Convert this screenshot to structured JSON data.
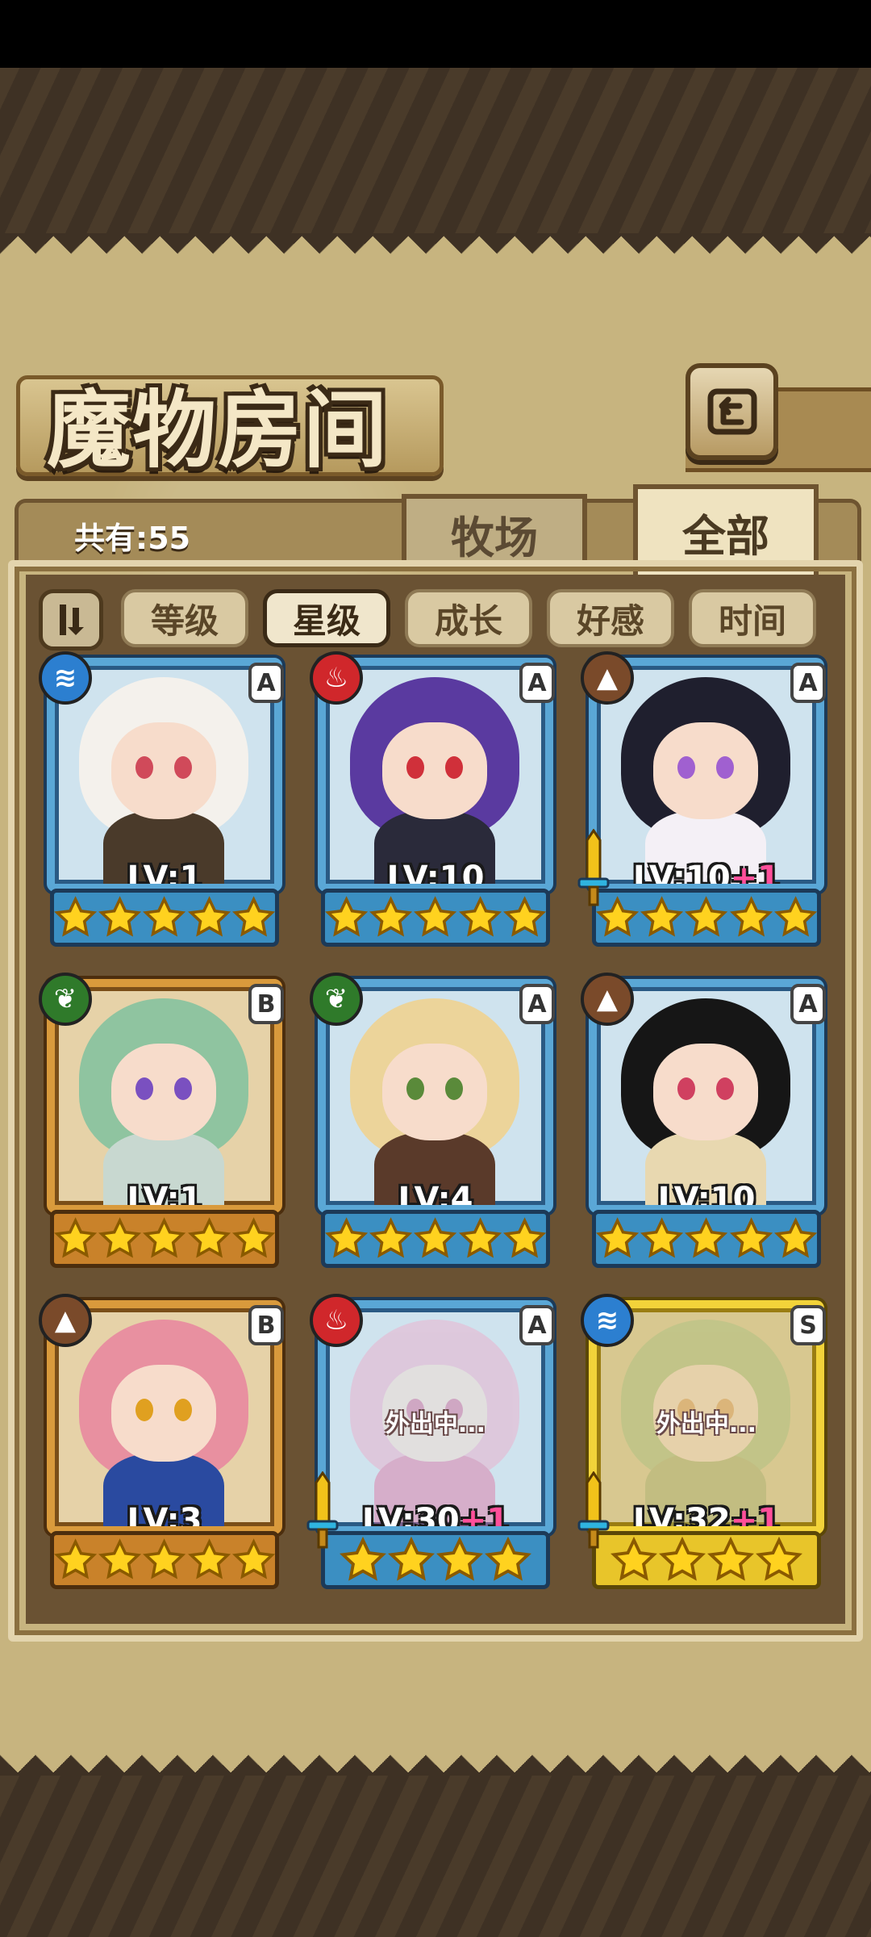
{
  "header": {
    "title": "魔物房间",
    "count": "共有:55"
  },
  "tabs": [
    {
      "label": "牧场"
    },
    {
      "label": "全部",
      "selected": true
    }
  ],
  "filters": {
    "sort_icon": "sort-toggle-icon",
    "options": [
      {
        "label": "等级",
        "active": false
      },
      {
        "label": "星级",
        "active": true
      },
      {
        "label": "成长",
        "active": false
      },
      {
        "label": "好感",
        "active": false
      },
      {
        "label": "时间",
        "active": false
      }
    ]
  },
  "monsters": [
    {
      "element": "water",
      "rank": "A",
      "level": "LV:1",
      "bonus": "",
      "stars": 5,
      "frame": "blue",
      "status": "",
      "hair": "#f4f1ec",
      "eye": "#d04a5a",
      "outfit": "#4a3a2a"
    },
    {
      "element": "fire",
      "rank": "A",
      "level": "LV:10",
      "bonus": "",
      "stars": 5,
      "frame": "blue",
      "status": "",
      "hair": "#5a3aa0",
      "eye": "#d0303a",
      "outfit": "#2a2a3a"
    },
    {
      "element": "earth",
      "rank": "A",
      "level": "LV:10",
      "bonus": "+1",
      "stars": 5,
      "frame": "blue",
      "status": "",
      "hair": "#1f1f2e",
      "eye": "#a060d0",
      "outfit": "#f4f0f6"
    },
    {
      "element": "nature",
      "rank": "B",
      "level": "LV:1",
      "bonus": "",
      "stars": 5,
      "frame": "orange",
      "status": "",
      "hair": "#8fc4a0",
      "eye": "#7a50c0",
      "outfit": "#c8d8d0"
    },
    {
      "element": "nature",
      "rank": "A",
      "level": "LV:4",
      "bonus": "",
      "stars": 5,
      "frame": "blue",
      "status": "",
      "hair": "#ecd49a",
      "eye": "#5a8a3a",
      "outfit": "#5a3a2a"
    },
    {
      "element": "earth",
      "rank": "A",
      "level": "LV:10",
      "bonus": "",
      "stars": 5,
      "frame": "blue",
      "status": "",
      "hair": "#161616",
      "eye": "#d04060",
      "outfit": "#e8d8b0"
    },
    {
      "element": "earth",
      "rank": "B",
      "level": "LV:3",
      "bonus": "",
      "stars": 5,
      "frame": "orange",
      "status": "",
      "hair": "#e890a0",
      "eye": "#e0a020",
      "outfit": "#2a4aa0"
    },
    {
      "element": "fire",
      "rank": "A",
      "level": "LV:30",
      "bonus": "+1",
      "stars": 4,
      "frame": "blue",
      "status": "外出中...",
      "hair": "#f0a8c8",
      "eye": "#d06090",
      "outfit": "#e070a0"
    },
    {
      "element": "water",
      "rank": "S",
      "level": "LV:32",
      "bonus": "+1",
      "stars": 4,
      "frame": "gold",
      "status": "外出中...",
      "hair": "#a8c080",
      "eye": "#e0a060",
      "outfit": "#a8b070"
    }
  ],
  "colors": {
    "parchment": "#c7b47f",
    "panel": "#6a5233",
    "pink_bonus": "#ff4f9a"
  }
}
